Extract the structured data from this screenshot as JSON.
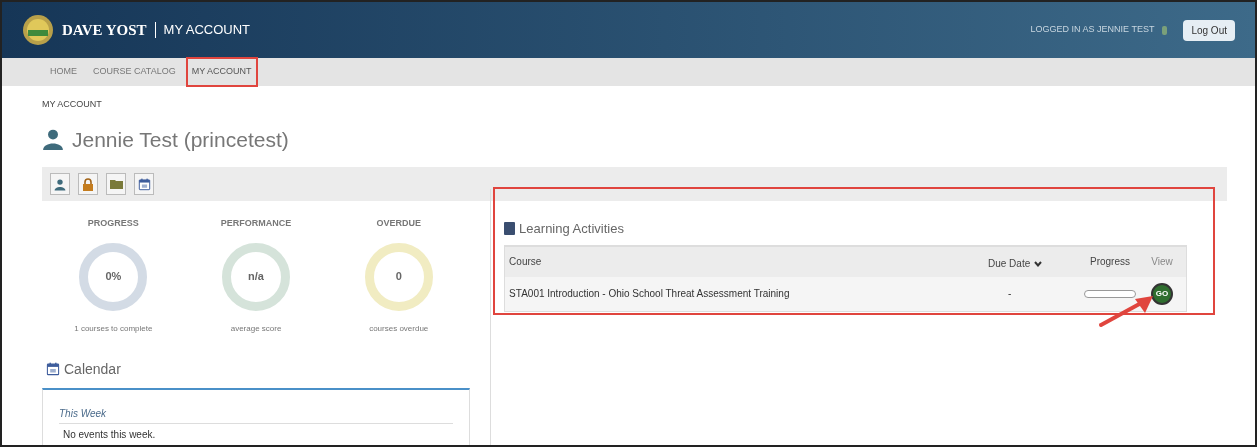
{
  "header": {
    "brand": "DAVE YOST",
    "section": "MY ACCOUNT",
    "logged_in": "LOGGED IN AS JENNIE TEST",
    "logout": "Log Out"
  },
  "nav": [
    {
      "label": "HOME",
      "selected": false
    },
    {
      "label": "COURSE CATALOG",
      "selected": false
    },
    {
      "label": "MY ACCOUNT",
      "selected": true
    }
  ],
  "breadcrumb": "MY ACCOUNT",
  "user_name": "Jennie Test (princetest)",
  "stats": [
    {
      "title": "PROGRESS",
      "value": "0%",
      "caption": "1 courses to complete",
      "color": "#d3dbe5"
    },
    {
      "title": "PERFORMANCE",
      "value": "n/a",
      "caption": "average score",
      "color": "#d5e3da"
    },
    {
      "title": "OVERDUE",
      "value": "0",
      "caption": "courses overdue",
      "color": "#f1ecc2"
    }
  ],
  "calendar": {
    "title": "Calendar",
    "week_label": "This Week",
    "empty": "No events this week."
  },
  "learning": {
    "title": "Learning Activities",
    "columns": [
      "Course",
      "Due Date",
      "Progress",
      "View"
    ],
    "rows": [
      {
        "course": "STA001 Introduction - Ohio School Threat Assessment Training",
        "due": "-",
        "level": 0,
        "action": "GO"
      }
    ]
  }
}
